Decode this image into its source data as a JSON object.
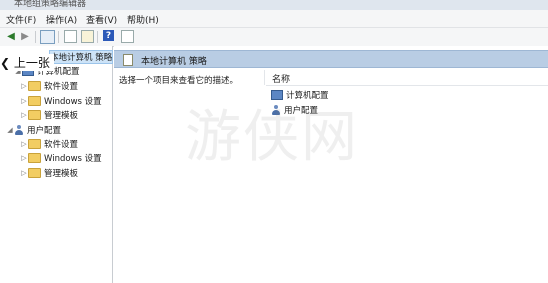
{
  "window": {
    "title": "本地组策略编辑器"
  },
  "menu": {
    "file": "文件(F)",
    "action": "操作(A)",
    "view": "查看(V)",
    "help": "帮助(H)"
  },
  "toolbar": {
    "help_glyph": "?"
  },
  "overlay": {
    "prev_label": "上一张"
  },
  "tree": {
    "root": "本地计算机 策略",
    "computer": "计算机配置",
    "c_software": "软件设置",
    "c_windows": "Windows 设置",
    "c_templates": "管理模板",
    "user": "用户配置",
    "u_software": "软件设置",
    "u_windows": "Windows 设置",
    "u_templates": "管理模板"
  },
  "right": {
    "header": "本地计算机 策略",
    "description": "选择一个项目来查看它的描述。",
    "column_name": "名称",
    "items": [
      "计算机配置",
      "用户配置"
    ]
  },
  "watermark": "游侠网",
  "colors": {
    "header_band": "#b9cde4",
    "folder": "#f2cd62",
    "selection": "#cde3f7"
  }
}
